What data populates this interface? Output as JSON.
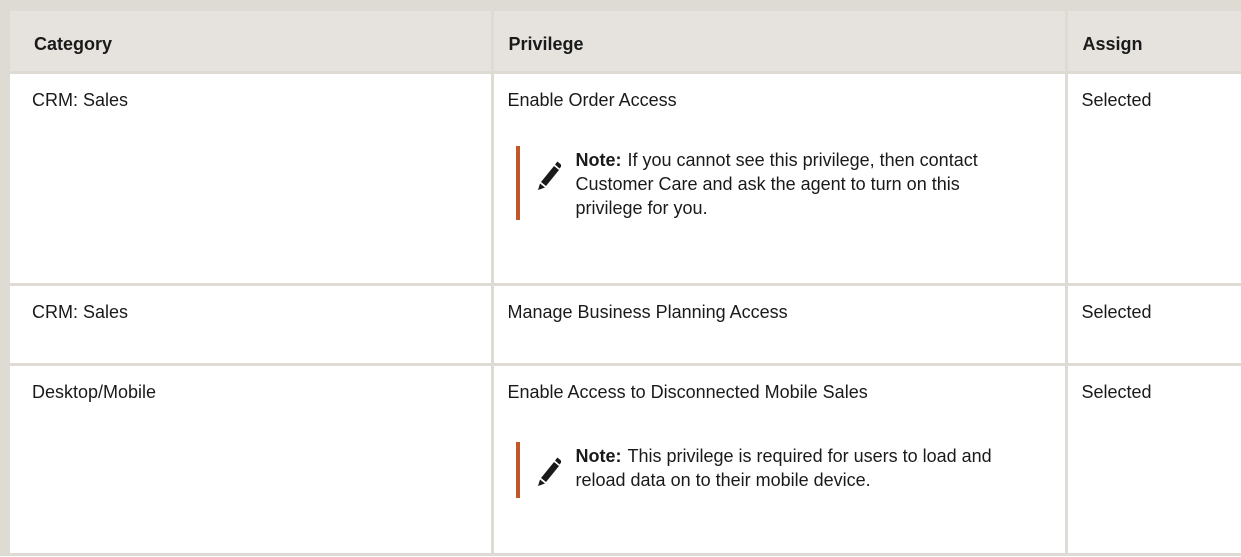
{
  "table": {
    "headers": {
      "category": "Category",
      "privilege": "Privilege",
      "assign": "Assign"
    },
    "rows": [
      {
        "category": "CRM: Sales",
        "privilege": "Enable Order Access",
        "assign": "Selected",
        "note": {
          "label": "Note:",
          "text": "If you cannot see this privilege, then contact Customer Care and ask the agent to turn on this privilege for you.",
          "icon": "pencil-icon"
        }
      },
      {
        "category": "CRM: Sales",
        "privilege": "Manage Business Planning Access",
        "assign": "Selected"
      },
      {
        "category": "Desktop/Mobile",
        "privilege": "Enable Access to Disconnected Mobile Sales",
        "assign": "Selected",
        "note": {
          "label": "Note:",
          "text": "This privilege is required for users to load and reload data on to their mobile device.",
          "icon": "pencil-icon"
        }
      }
    ]
  },
  "colors": {
    "header_bg": "#e6e3de",
    "border": "#dedad4",
    "note_accent": "#c2562b"
  }
}
